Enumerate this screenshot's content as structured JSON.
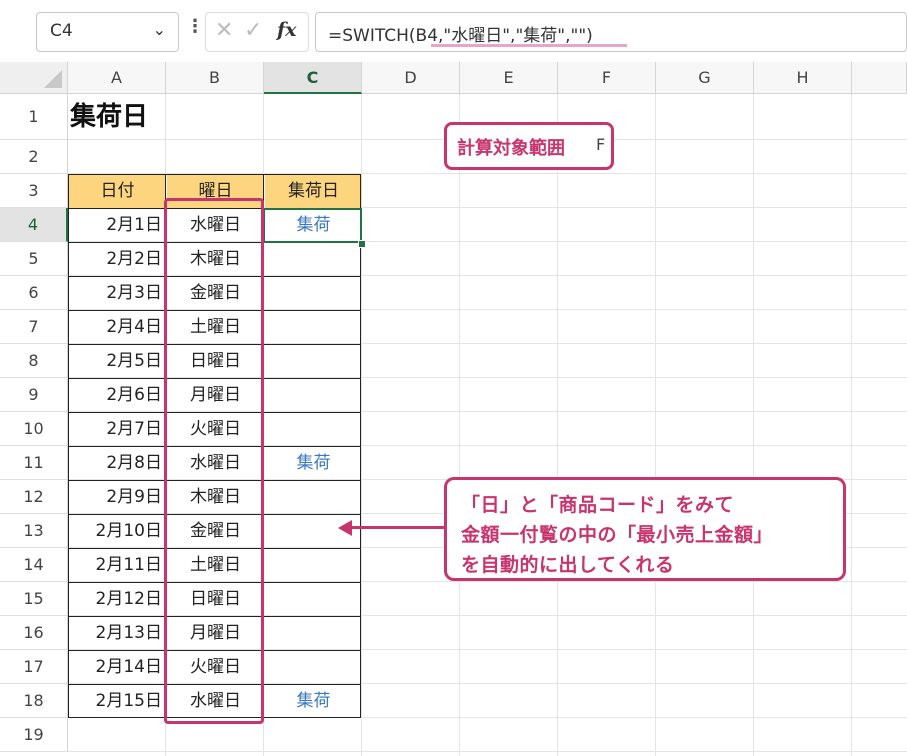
{
  "name_box": {
    "value": "C4"
  },
  "formula_bar": {
    "separator": "⋮",
    "cancel": "✕",
    "enter": "✓",
    "fx": "fx",
    "formula": "=SWITCH(B4,\"水曜日\",\"集荷\",\"\")"
  },
  "columns": [
    "A",
    "B",
    "C",
    "D",
    "E",
    "F",
    "G",
    "H"
  ],
  "rows": [
    "1",
    "2",
    "3",
    "4",
    "5",
    "6",
    "7",
    "8",
    "9",
    "10",
    "11",
    "12",
    "13",
    "14",
    "15",
    "16",
    "17",
    "18",
    "19"
  ],
  "title": "集荷日",
  "table": {
    "headers": [
      "日付",
      "曜日",
      "集荷日"
    ],
    "rows": [
      [
        "2月1日",
        "水曜日",
        "集荷"
      ],
      [
        "2月2日",
        "木曜日",
        ""
      ],
      [
        "2月3日",
        "金曜日",
        ""
      ],
      [
        "2月4日",
        "土曜日",
        ""
      ],
      [
        "2月5日",
        "日曜日",
        ""
      ],
      [
        "2月6日",
        "月曜日",
        ""
      ],
      [
        "2月7日",
        "火曜日",
        ""
      ],
      [
        "2月8日",
        "水曜日",
        "集荷"
      ],
      [
        "2月9日",
        "木曜日",
        ""
      ],
      [
        "2月10日",
        "金曜日",
        ""
      ],
      [
        "2月11日",
        "土曜日",
        ""
      ],
      [
        "2月12日",
        "日曜日",
        ""
      ],
      [
        "2月13日",
        "月曜日",
        ""
      ],
      [
        "2月14日",
        "火曜日",
        ""
      ],
      [
        "2月15日",
        "水曜日",
        "集荷"
      ]
    ]
  },
  "annotations": {
    "range_label": "計算対象範囲",
    "range_label_tail": "F",
    "callout_lines": [
      "「日」と「商品コード」をみて",
      "金額一付覧の中の「最小売上金額」",
      "を自動的に出してくれる"
    ]
  },
  "colors": {
    "accent": "#c8346e",
    "header_fill": "#fdd57e",
    "excel_green": "#217346",
    "link_blue": "#3b78c4"
  }
}
